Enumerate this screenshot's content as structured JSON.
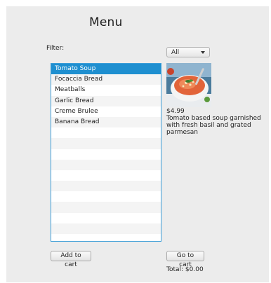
{
  "title": "Menu",
  "filter": {
    "label": "Filter:",
    "selected": "All"
  },
  "menu_items": [
    "Tomato Soup",
    "Focaccia Bread",
    "Meatballs",
    "Garlic Bread",
    "Creme Brulee",
    "Banana Bread",
    "",
    "",
    "",
    "",
    "",
    "",
    "",
    "",
    "",
    "",
    ""
  ],
  "selected_index": 0,
  "detail": {
    "image_icon": "tomato-soup-photo",
    "price": "$4.99",
    "description": "Tomato based soup garnished with fresh basil and grated parmesan"
  },
  "buttons": {
    "add_to_cart": "Add to cart",
    "go_to_cart": "Go to cart"
  },
  "total": "Total: $0.00",
  "colors": {
    "selection": "#1e8fd0",
    "list_border": "#3b9dd8"
  }
}
